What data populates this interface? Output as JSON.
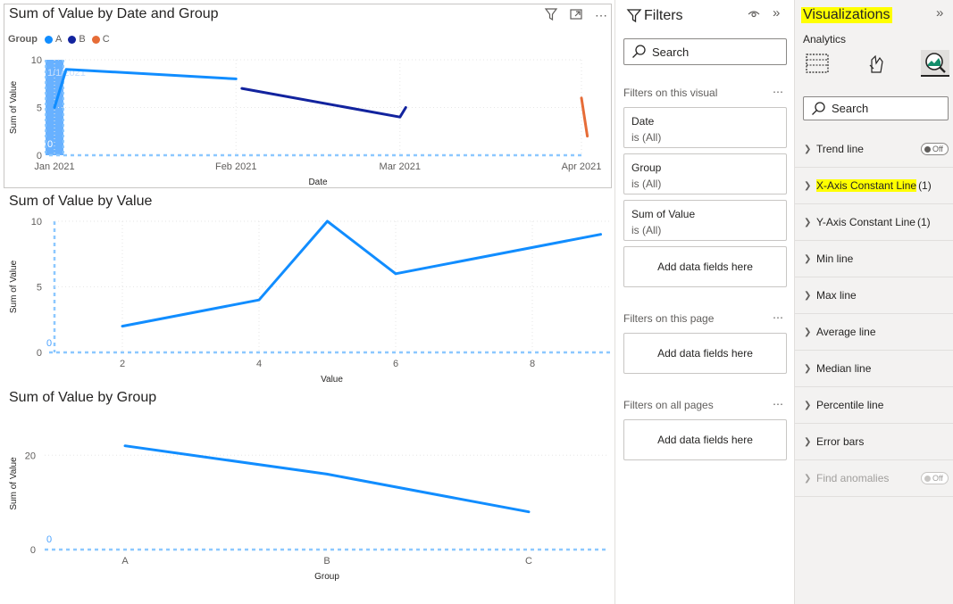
{
  "canvas": {
    "visual1": {
      "title": "Sum of Value by Date and Group",
      "legend_title": "Group",
      "legend": [
        {
          "name": "A",
          "color": "#118DFF"
        },
        {
          "name": "B",
          "color": "#12239E"
        },
        {
          "name": "C",
          "color": "#E66C37"
        }
      ],
      "header_icons": [
        "filter-icon",
        "focus-mode-icon",
        "more-options-icon"
      ],
      "more_label": "⋯"
    },
    "visual2": {
      "title": "Sum of Value by Value"
    },
    "visual3": {
      "title": "Sum of Value by Group"
    }
  },
  "chart_data": [
    {
      "type": "line",
      "title": "Sum of Value by Date and Group",
      "xlabel": "Date",
      "ylabel": "Sum of Value",
      "x_ticks": [
        "Jan 2021",
        "Feb 2021",
        "Mar 2021",
        "Apr 2021"
      ],
      "y_ticks": [
        "0",
        "5",
        "10"
      ],
      "ylim": [
        0,
        10
      ],
      "constant_line": {
        "value_label": "0"
      },
      "band_label": "1/1/2021",
      "series": [
        {
          "name": "A",
          "color": "#118DFF",
          "points": [
            [
              "2021-01-01",
              5
            ],
            [
              "2021-01-03",
              9
            ],
            [
              "2021-02-01",
              8
            ]
          ]
        },
        {
          "name": "B",
          "color": "#12239E",
          "points": [
            [
              "2021-02-02",
              7
            ],
            [
              "2021-03-01",
              4
            ],
            [
              "2021-03-02",
              5
            ]
          ]
        },
        {
          "name": "C",
          "color": "#E66C37",
          "points": [
            [
              "2021-04-01",
              6
            ],
            [
              "2021-04-02",
              2
            ]
          ]
        }
      ]
    },
    {
      "type": "line",
      "title": "Sum of Value by Value",
      "xlabel": "Value",
      "ylabel": "Sum of Value",
      "x_ticks": [
        "2",
        "4",
        "6",
        "8"
      ],
      "y_ticks": [
        "0",
        "5",
        "10"
      ],
      "ylim": [
        0,
        10
      ],
      "constant_line": {
        "value_label": "0"
      },
      "series": [
        {
          "color": "#118DFF",
          "x": [
            2,
            4,
            5,
            6,
            9
          ],
          "y": [
            2,
            4,
            10,
            6,
            9
          ]
        }
      ]
    },
    {
      "type": "line",
      "title": "Sum of Value by Group",
      "xlabel": "Group",
      "ylabel": "Sum of Value",
      "categories": [
        "A",
        "B",
        "C"
      ],
      "y_ticks": [
        "0",
        "20"
      ],
      "ylim": [
        0,
        28
      ],
      "constant_line": {
        "value_label": "0"
      },
      "series": [
        {
          "color": "#118DFF",
          "values": [
            22,
            16,
            8
          ]
        }
      ]
    }
  ],
  "filters": {
    "title": "Filters",
    "search_placeholder": "Search",
    "section_visual": "Filters on this visual",
    "section_page": "Filters on this page",
    "section_all": "Filters on all pages",
    "more": "⋯",
    "cards": [
      {
        "field": "Date",
        "state": "is (All)"
      },
      {
        "field": "Group",
        "state": "is (All)"
      },
      {
        "field": "Sum of Value",
        "state": "is (All)"
      }
    ],
    "add_label": "Add data fields here"
  },
  "visualizations": {
    "title": "Visualizations",
    "subtitle": "Analytics",
    "search_placeholder": "Search",
    "tabs": [
      "build-visual-icon",
      "format-visual-icon",
      "analytics-icon"
    ],
    "rows": [
      {
        "label": "Trend line",
        "toggle": "Off"
      },
      {
        "label": "X-Axis Constant Line",
        "count": "(1)",
        "highlight": true
      },
      {
        "label": "Y-Axis Constant Line",
        "count": "(1)"
      },
      {
        "label": "Min line"
      },
      {
        "label": "Max line"
      },
      {
        "label": "Average line"
      },
      {
        "label": "Median line"
      },
      {
        "label": "Percentile line"
      },
      {
        "label": "Error bars"
      },
      {
        "label": "Find anomalies",
        "toggle": "Off",
        "disabled": true
      }
    ]
  }
}
